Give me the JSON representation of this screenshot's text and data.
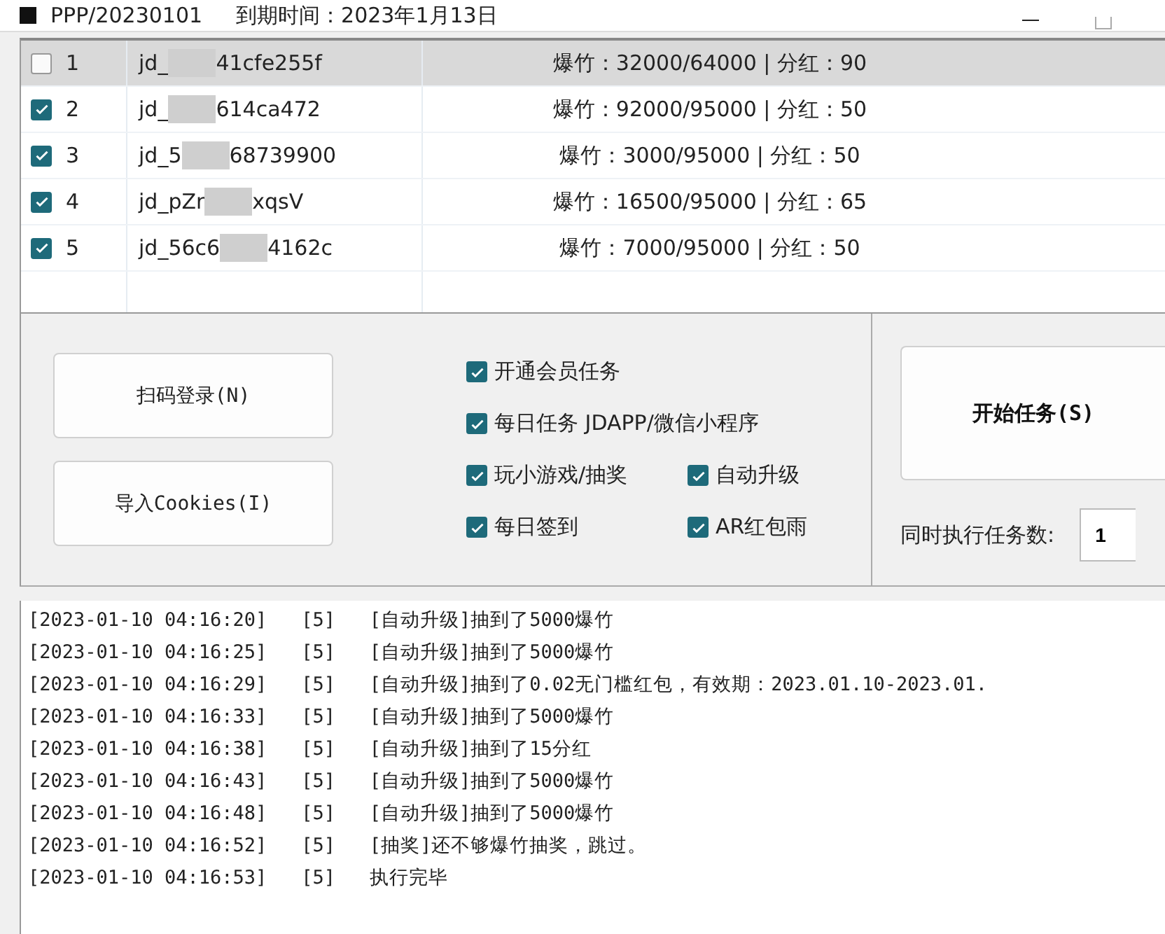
{
  "window": {
    "title": "PPP/20230101",
    "expiry": "到期时间：2023年1月13日"
  },
  "accounts": [
    {
      "checked": false,
      "selected": true,
      "index": "1",
      "id_start": "jd_",
      "id_end": "41cfe255f",
      "stats": "爆竹：32000/64000 | 分红：90"
    },
    {
      "checked": true,
      "selected": false,
      "index": "2",
      "id_start": "jd_",
      "id_end": "614ca472",
      "stats": "爆竹：92000/95000 | 分红：50"
    },
    {
      "checked": true,
      "selected": false,
      "index": "3",
      "id_start": "jd_5",
      "id_end": "68739900",
      "stats": "爆竹：3000/95000 | 分红：50"
    },
    {
      "checked": true,
      "selected": false,
      "index": "4",
      "id_start": "jd_pZr",
      "id_end": "xqsV",
      "stats": "爆竹：16500/95000 | 分红：65"
    },
    {
      "checked": true,
      "selected": false,
      "index": "5",
      "id_start": "jd_56c6",
      "id_end": "4162c",
      "stats": "爆竹：7000/95000 | 分红：50"
    }
  ],
  "buttons": [
    "扫码登录(N)",
    "导入Cookies(I)"
  ],
  "options": [
    {
      "label": "开通会员任务",
      "checked": true
    },
    {
      "label": "每日任务 JDAPP/微信小程序",
      "checked": true
    },
    {
      "label": "玩小游戏/抽奖",
      "checked": true
    },
    {
      "label": "自动升级",
      "checked": true
    },
    {
      "label": "每日签到",
      "checked": true
    },
    {
      "label": "AR红包雨",
      "checked": true
    }
  ],
  "start_button": "开始任务(S)",
  "concurrency": {
    "label": "同时执行任务数:",
    "value": "1"
  },
  "log": [
    "[2023-01-10 04:16:20]   [5]   [自动升级]抽到了5000爆竹",
    "[2023-01-10 04:16:25]   [5]   [自动升级]抽到了5000爆竹",
    "[2023-01-10 04:16:29]   [5]   [自动升级]抽到了0.02无门槛红包，有效期：2023.01.10-2023.01.",
    "[2023-01-10 04:16:33]   [5]   [自动升级]抽到了5000爆竹",
    "[2023-01-10 04:16:38]   [5]   [自动升级]抽到了15分红",
    "[2023-01-10 04:16:43]   [5]   [自动升级]抽到了5000爆竹",
    "[2023-01-10 04:16:48]   [5]   [自动升级]抽到了5000爆竹",
    "[2023-01-10 04:16:52]   [5]   [抽奖]还不够爆竹抽奖，跳过。",
    "[2023-01-10 04:16:53]   [5]   执行完毕"
  ]
}
